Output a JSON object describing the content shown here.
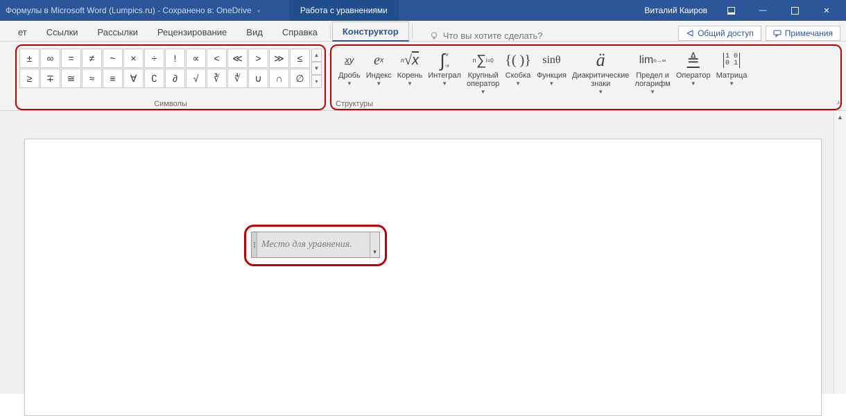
{
  "titlebar": {
    "doc_title": "Формулы в Microsoft Word (Lumpics.ru)",
    "save_status": "Сохранено в: OneDrive",
    "contextual_title": "Работа с уравнениями",
    "user": "Виталий Каиров"
  },
  "tabs": {
    "left": [
      "ет",
      "Ссылки",
      "Рассылки",
      "Рецензирование",
      "Вид",
      "Справка"
    ],
    "active": "Конструктор",
    "search_placeholder": "Что вы хотите сделать?",
    "share": "Общий доступ",
    "comments": "Примечания"
  },
  "symbols": {
    "label": "Символы",
    "row1": [
      "±",
      "∞",
      "=",
      "≠",
      "~",
      "×",
      "÷",
      "!",
      "∝",
      "<",
      "≪",
      ">",
      "≫",
      "≤"
    ],
    "row2": [
      "≥",
      "∓",
      "≅",
      "≈",
      "≡",
      "∀",
      "∁",
      "∂",
      "√",
      "∛",
      "∜",
      "∪",
      "∩",
      "∅"
    ]
  },
  "structures": {
    "label": "Структуры",
    "items": [
      {
        "icon": "frac",
        "label": "Дробь"
      },
      {
        "icon": "script",
        "label": "Индекс"
      },
      {
        "icon": "radical",
        "label": "Корень"
      },
      {
        "icon": "integral",
        "label": "Интеграл"
      },
      {
        "icon": "largeop",
        "label": "Крупный\nоператор"
      },
      {
        "icon": "bracket",
        "label": "Скобка"
      },
      {
        "icon": "function",
        "label": "Функция"
      },
      {
        "icon": "accent",
        "label": "Диакритические\nзнаки"
      },
      {
        "icon": "limit",
        "label": "Предел и\nлогарифм"
      },
      {
        "icon": "operator",
        "label": "Оператор"
      },
      {
        "icon": "matrix",
        "label": "Матрица"
      }
    ]
  },
  "equation": {
    "placeholder": "Место для уравнения."
  }
}
